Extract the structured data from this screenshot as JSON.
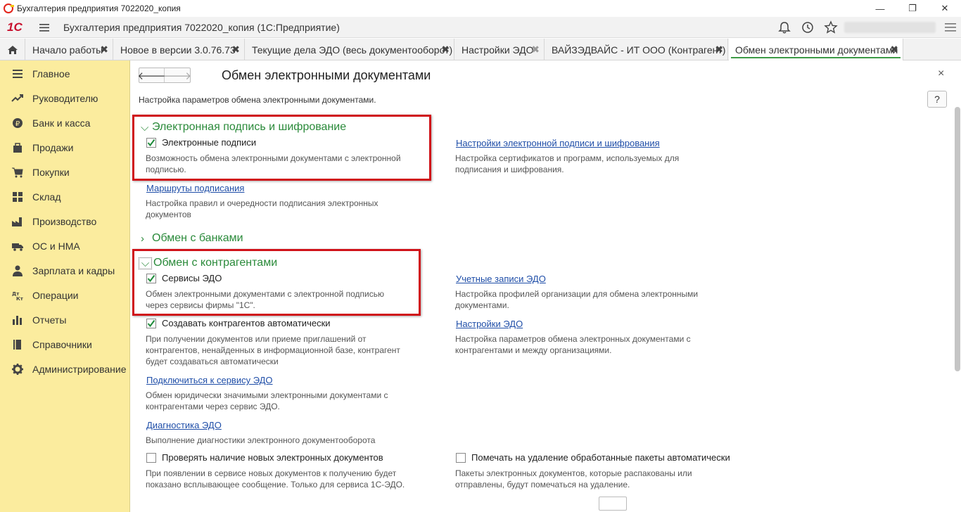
{
  "window": {
    "title": "Бухгалтерия предприятия 7022020_копия",
    "controls": {
      "minimize": "—",
      "restore": "❐",
      "close": "✕"
    }
  },
  "toolbar": {
    "logo": "1С",
    "app_title": "Бухгалтерия предприятия 7022020_копия  (1С:Предприятие)"
  },
  "tabs": [
    {
      "label": "Начало работы"
    },
    {
      "label": "Новое в версии 3.0.76.73"
    },
    {
      "label": "Текущие дела ЭДО (весь документооборот)"
    },
    {
      "label": "Настройки ЭДО"
    },
    {
      "label": "ВАЙЗЭДВАЙС - ИТ ООО (Контрагент)"
    },
    {
      "label": "Обмен электронными документами"
    }
  ],
  "sidebar": {
    "items": [
      {
        "label": "Главное",
        "icon": "menu-icon"
      },
      {
        "label": "Руководителю",
        "icon": "trend-icon"
      },
      {
        "label": "Банк и касса",
        "icon": "coin-icon"
      },
      {
        "label": "Продажи",
        "icon": "bag-icon"
      },
      {
        "label": "Покупки",
        "icon": "cart-icon"
      },
      {
        "label": "Склад",
        "icon": "grid-icon"
      },
      {
        "label": "Производство",
        "icon": "factory-icon"
      },
      {
        "label": "ОС и НМА",
        "icon": "truck-icon"
      },
      {
        "label": "Зарплата и кадры",
        "icon": "person-icon"
      },
      {
        "label": "Операции",
        "icon": "dt-kt-icon"
      },
      {
        "label": "Отчеты",
        "icon": "barchart-icon"
      },
      {
        "label": "Справочники",
        "icon": "book-icon"
      },
      {
        "label": "Администрирование",
        "icon": "gear-icon"
      }
    ]
  },
  "page": {
    "title": "Обмен электронными документами",
    "subtitle": "Настройка параметров обмена электронными документами.",
    "help": "?",
    "close": "×"
  },
  "sections": {
    "signature": {
      "title": "Электронная подпись и шифрование",
      "checkbox_label": "Электронные подписи",
      "checkbox_checked": true,
      "desc_line1": "Возможность обмена электронными документами с электронной",
      "desc_line2": "подписью.",
      "settings_link": "Настройки электронной подписи и шифрования",
      "settings_desc_line1": "Настройка сертификатов и программ, используемых для",
      "settings_desc_line2": "подписания и шифрования.",
      "routes_link": "Маршруты подписания",
      "routes_desc_line1": "Настройка правил и очередности подписания электронных",
      "routes_desc_line2": "документов"
    },
    "banks": {
      "title": "Обмен с банками"
    },
    "counterparties": {
      "title": "Обмен с контрагентами",
      "edo_label": "Сервисы ЭДО",
      "edo_checked": true,
      "edo_desc_line1": "Обмен электронными документами с электронной подписью",
      "edo_desc_line2": "через сервисы фирмы \"1С\".",
      "accounts_link": "Учетные записи ЭДО",
      "accounts_desc_line1": "Настройка профилей организации для обмена электронными",
      "accounts_desc_line2": "документами.",
      "auto_create_label": "Создавать контрагентов автоматически",
      "auto_create_checked": true,
      "auto_desc_line1": "При получении документов или приеме приглашений от",
      "auto_desc_line2": "контрагентов, ненайденных в информационной базе, контрагент",
      "auto_desc_line3": "будет создаваться автоматически",
      "edo_settings_link": "Настройки ЭДО",
      "edo_settings_desc_line1": "Настройка параметров обмена электронных документами с",
      "edo_settings_desc_line2": "контрагентами и между организациями.",
      "connect_link": "Подключиться к сервису ЭДО",
      "connect_desc_line1": "Обмен юридически значимыми электронными документами с",
      "connect_desc_line2": "контрагентами через сервис ЭДО.",
      "diag_link": "Диагностика ЭДО",
      "diag_desc": "Выполнение диагностики электронного документооборота",
      "check_new_label": "Проверять наличие новых электронных документов",
      "check_new_checked": false,
      "check_new_desc_line1": "При появлении в сервисе новых документов к получению будет",
      "check_new_desc_line2": "показано всплывающее сообщение. Только для сервиса 1С-ЭДО.",
      "mark_delete_label": "Помечать на удаление обработанные пакеты автоматически",
      "mark_delete_checked": false,
      "mark_delete_desc_line1": "Пакеты электронных документов, которые распакованы или",
      "mark_delete_desc_line2": "отправлены, будут помечаться на удаление."
    }
  },
  "colors": {
    "accent_green": "#2a8a3a",
    "sidebar_bg": "#fbec9e",
    "highlight_red": "#d0131a",
    "link_blue": "#1f4ea8"
  }
}
